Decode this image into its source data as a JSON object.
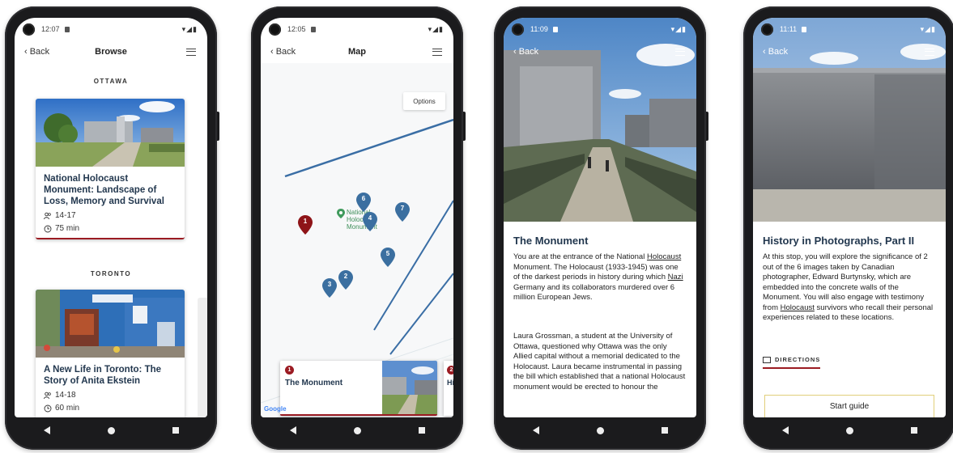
{
  "screens": {
    "browse": {
      "status_time": "12:07",
      "back_label": "‹ Back",
      "title": "Browse",
      "sections": [
        {
          "city": "OTTAWA",
          "card": {
            "title": "National Holocaust Monument: Landscape of Loss, Memory and Survival",
            "ages": "14-17",
            "duration": "75 min"
          }
        },
        {
          "city": "TORONTO",
          "card": {
            "title": "A New Life in Toronto: The Story of Anita Ekstein",
            "ages": "14-18",
            "duration": "60 min"
          }
        }
      ]
    },
    "map": {
      "status_time": "12:05",
      "back_label": "‹ Back",
      "title": "Map",
      "options_label": "Options",
      "poi_label": "National Holocaust Monument",
      "pins": [
        "1",
        "2",
        "3",
        "4",
        "5",
        "6",
        "7"
      ],
      "card": {
        "number": "1",
        "title": "The Monument"
      },
      "next_card": {
        "number": "2",
        "title": "History"
      },
      "google_label": "Google"
    },
    "monument": {
      "status_time": "11:09",
      "back_label": "‹ Back",
      "title": "The Monument",
      "paragraph1_parts": [
        "You are at the entrance of the National ",
        "Holocaust",
        " Monument. The Holocaust (1933-1945) was one of the darkest periods in history during which ",
        "Nazi",
        " Germany and its collaborators murdered over 6 million European Jews."
      ],
      "paragraph2": "Laura Grossman, a student at the University of Ottawa, questioned why Ottawa was the only Allied capital without a memorial dedicated to the Holocaust. Laura became instrumental in passing the bill which established that a national Holocaust monument would be erected to honour the"
    },
    "photographs": {
      "status_time": "11:11",
      "back_label": "‹ Back",
      "title": "History in Photographs, Part II",
      "paragraph_parts": [
        "At this stop, you will explore the significance of 2 out of the 6 images taken by Canadian photographer, Edward Burtynsky, which are embedded into the concrete walls of the Monument. You will also engage with testimony from ",
        "Holocaust",
        " survivors who recall their personal experiences related to these locations."
      ],
      "directions_label": "DIRECTIONS",
      "start_label": "Start guide"
    }
  },
  "colors": {
    "accent": "#9b1b22",
    "title": "#23384f",
    "pin_blue": "#3b6fa0",
    "pin_red": "#8e1418",
    "road": "#3a6ea5"
  },
  "status_icons": "▾◢▮"
}
